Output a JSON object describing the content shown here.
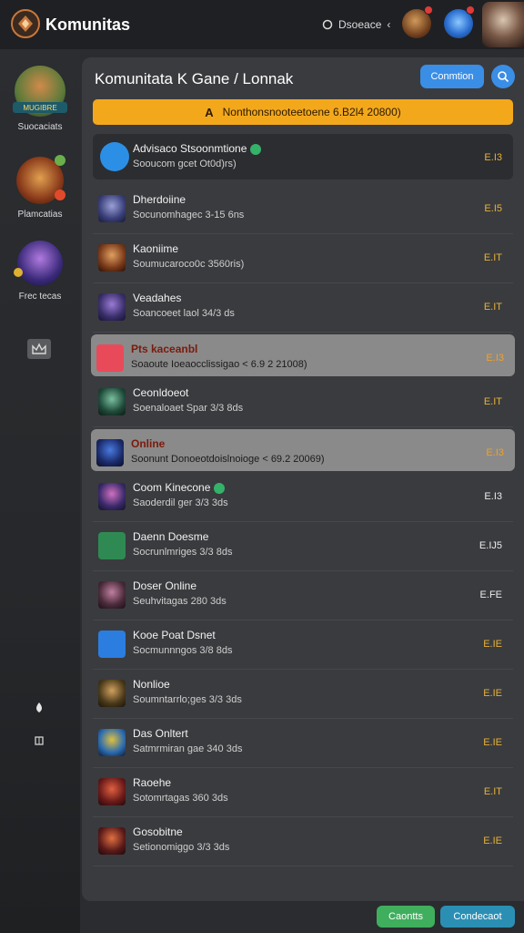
{
  "app": {
    "title": "Komunitas"
  },
  "topbar": {
    "status_text": "Dsoeace",
    "status_caret": "‹"
  },
  "sidebar": {
    "items": [
      {
        "label": "Suocaciats",
        "icon": "warrior-avatar-icon",
        "badge": "MUGIBRE"
      },
      {
        "label": "Plamcatias",
        "icon": "archer-avatar-icon"
      },
      {
        "label": "Frec tecas",
        "icon": "mage-avatar-icon"
      }
    ],
    "bottom_icons": [
      "home-icon",
      "moon-icon",
      "drop-icon",
      "book-icon"
    ]
  },
  "panel": {
    "title": "Komunitata K Gane / Lonnak",
    "connect_button": "Conmtion",
    "alert_icon": "A",
    "alert_text": "Nonthonsnooteetoene 6.B2l4 20800)"
  },
  "rows": [
    {
      "name": "Advisaco Stsoonmtione",
      "sub": "Sooucom gcet Ot0d)rs)",
      "value": "E.I3",
      "variant": "first",
      "online": true
    },
    {
      "name": "Dherdoiine",
      "sub": "Socunomhagec 3-15 6ns",
      "value": "E.I5",
      "variant": "normal"
    },
    {
      "name": "Kaoniime",
      "sub": "Soumucaroco0c 3560ris)",
      "value": "E.IT",
      "variant": "normal"
    },
    {
      "name": "Veadahes",
      "sub": "Soancoeet laol 34/3 ds",
      "value": "E.IT",
      "variant": "normal"
    },
    {
      "name": "Pts kaceanbl",
      "sub": "Soaoute Ioeaocclissigao < 6.9 2 21008)",
      "value": "E.I3",
      "variant": "hl"
    },
    {
      "name": "Ceonldoeot",
      "sub": "Soenaloaet Spar 3/3 8ds",
      "value": "E.IT",
      "variant": "normal"
    },
    {
      "name": "Online",
      "sub": "Soonunt Donoeotdoislnoioge < 69.2 20069)",
      "value": "E.I3",
      "variant": "hl"
    },
    {
      "name": "Coom Kinecone",
      "sub": "Saoderdil ger 3/3 3ds",
      "value": "E.I3",
      "variant": "normal",
      "online": true,
      "value_white": true
    },
    {
      "name": "Daenn Doesme",
      "sub": "Socrunlmriges 3/3 8ds",
      "value": "E.IJ5",
      "variant": "normal",
      "value_white": true
    },
    {
      "name": "Doser Online",
      "sub": "Seuhvitagas 280 3ds",
      "value": "E.FE",
      "variant": "normal",
      "value_white": true
    },
    {
      "name": "Kooe Poat Dsnet",
      "sub": "Socmunnngos 3/8 8ds",
      "value": "E.IE",
      "variant": "normal"
    },
    {
      "name": "Nonlioe",
      "sub": "Soumntarrlo;ges 3/3 3ds",
      "value": "E.IE",
      "variant": "normal"
    },
    {
      "name": "Das Onltert",
      "sub": "Satmrmiran gae 340 3ds",
      "value": "E.IE",
      "variant": "normal"
    },
    {
      "name": "Raoehe",
      "sub": "Sotomrtagas 360 3ds",
      "value": "E.IT",
      "variant": "normal"
    },
    {
      "name": "Gosobitne",
      "sub": "Setionomiggo 3/3 3ds",
      "value": "E.IE",
      "variant": "normal"
    }
  ],
  "footer": {
    "green_button": "Caontts",
    "teal_button": "Condecaot"
  },
  "colors": {
    "accent": "#3a8ee6",
    "alert": "#f3a81c",
    "value": "#e6b23a",
    "online": "#35b26a"
  }
}
